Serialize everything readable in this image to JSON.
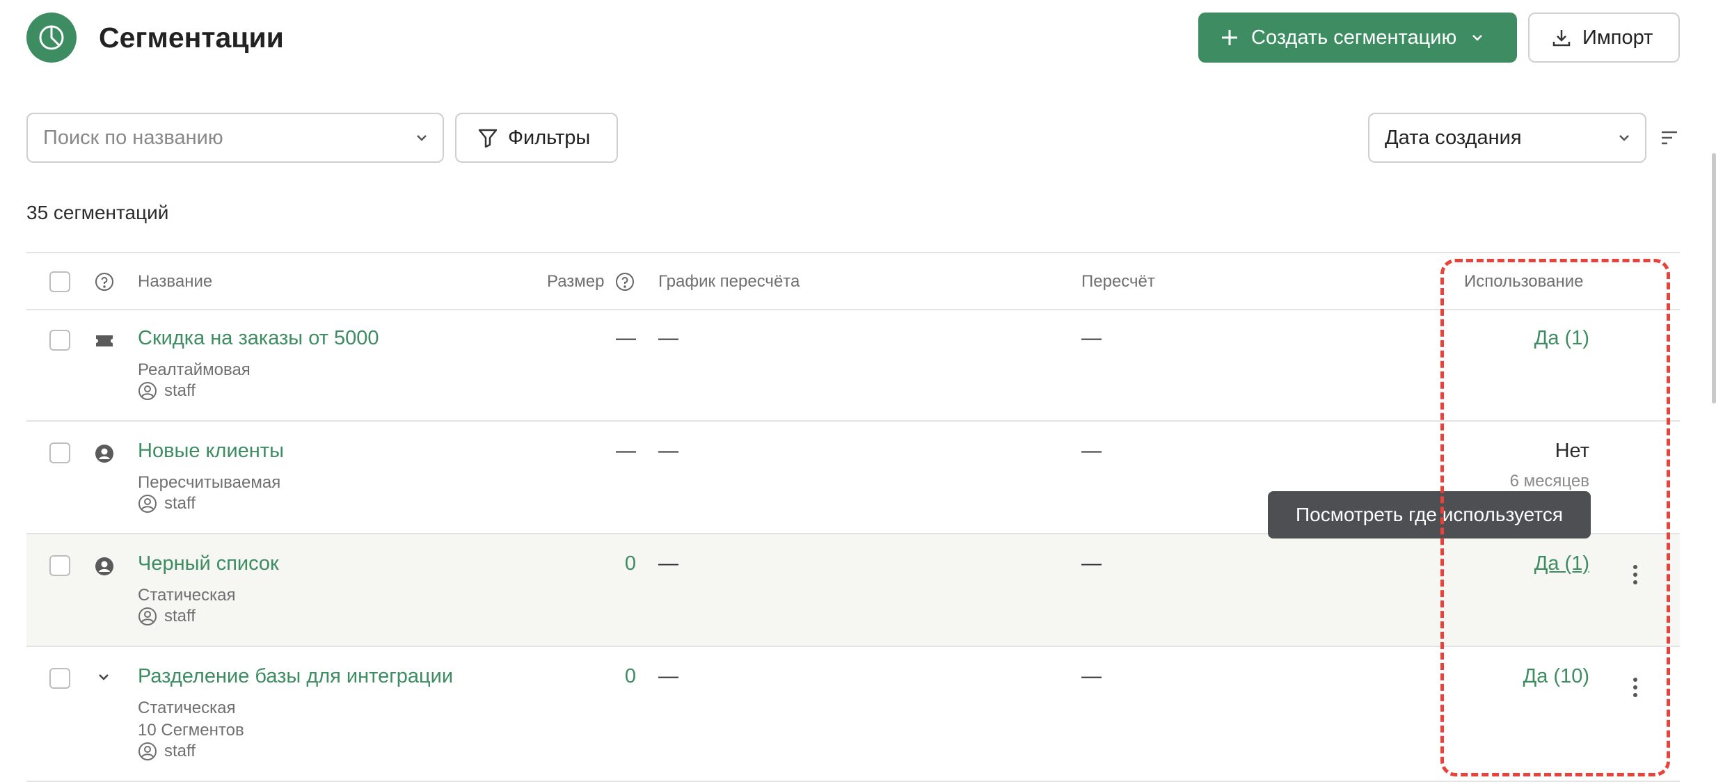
{
  "header": {
    "title": "Сегментации",
    "create_label": "Создать сегментацию",
    "import_label": "Импорт"
  },
  "toolbar": {
    "search_placeholder": "Поиск по названию",
    "filters_label": "Фильтры",
    "sort_value": "Дата создания"
  },
  "summary": {
    "count_text": "35 сегментаций"
  },
  "table": {
    "columns": {
      "name": "Название",
      "size": "Размер",
      "schedule": "График пересчёта",
      "recalc": "Пересчёт",
      "usage": "Использование"
    },
    "rows": [
      {
        "name": "Скидка на заказы от 5000",
        "type": "Реалтаймовая",
        "extra": "",
        "owner": "staff",
        "size": "—",
        "schedule": "—",
        "recalc": "—",
        "usage": "Да (1)",
        "usage_sub": "",
        "row_icon": "ticket-icon"
      },
      {
        "name": "Новые клиенты",
        "type": "Пересчитываемая",
        "extra": "",
        "owner": "staff",
        "size": "—",
        "schedule": "—",
        "recalc": "—",
        "usage": "Нет",
        "usage_sub": "6 месяцев",
        "row_icon": "user-icon"
      },
      {
        "name": "Черный список",
        "type": "Статическая",
        "extra": "",
        "owner": "staff",
        "size": "0",
        "schedule": "—",
        "recalc": "—",
        "usage": "Да (1)",
        "usage_sub": "",
        "row_icon": "user-icon"
      },
      {
        "name": "Разделение базы для интеграции",
        "type": "Статическая",
        "extra": "10 Сегментов",
        "owner": "staff",
        "size": "0",
        "schedule": "—",
        "recalc": "—",
        "usage": "Да (10)",
        "usage_sub": "",
        "row_icon": "chevron-down-icon"
      }
    ]
  },
  "tooltip": {
    "text": "Посмотреть где используется"
  },
  "colors": {
    "accent": "#3d8c62",
    "highlight": "#e8433a",
    "tooltip_bg": "#4d4f52"
  }
}
